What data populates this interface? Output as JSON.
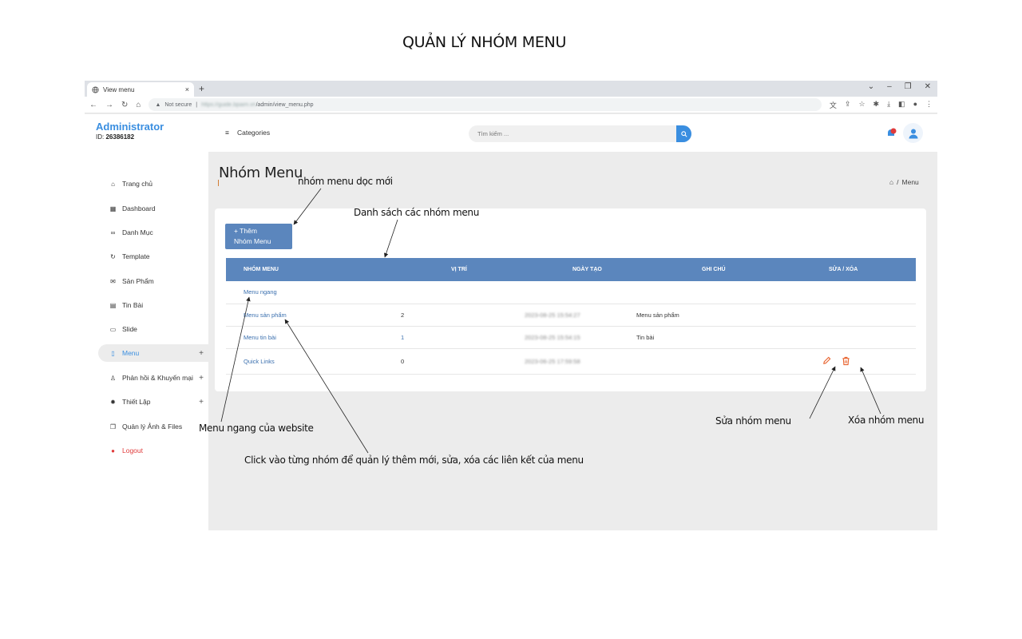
{
  "page_heading": "QUẢN LÝ NHÓM MENU",
  "browser": {
    "tab_title": "View menu",
    "tab_close": "×",
    "new_tab": "+",
    "url_security": "Not secure",
    "url_host": "https://guide.bpaim.vn",
    "url_path": "/admin/view_menu.php"
  },
  "header": {
    "brand": "Administrator",
    "id_label": "ID:",
    "id_value": "26386182",
    "categories_label": "Categories",
    "search_placeholder": "Tìm kiếm ..."
  },
  "sidebar": {
    "items": [
      {
        "label": "Trang chủ",
        "icon": "home-icon"
      },
      {
        "label": "Dashboard",
        "icon": "grid-icon"
      },
      {
        "label": "Danh Mục",
        "icon": "link-icon"
      },
      {
        "label": "Template",
        "icon": "refresh-icon"
      },
      {
        "label": "Sản Phẩm",
        "icon": "envelope-icon"
      },
      {
        "label": "Tin Bài",
        "icon": "newspaper-icon"
      },
      {
        "label": "Slide",
        "icon": "monitor-icon"
      },
      {
        "label": "Menu",
        "icon": "document-icon"
      },
      {
        "label": "Phản hồi & Khuyến mại",
        "icon": "user-icon"
      },
      {
        "label": "Thiết Lập",
        "icon": "gear-icon"
      },
      {
        "label": "Quản lý Ảnh & Files",
        "icon": "files-icon"
      },
      {
        "label": "Logout",
        "icon": "power-icon"
      }
    ],
    "plus": "+"
  },
  "main": {
    "title": "Nhóm Menu",
    "breadcrumb": "Menu",
    "breadcrumb_sep": "/",
    "add_button_line1": "+ Thêm",
    "add_button_line2": "Nhóm Menu",
    "columns": [
      "NHÓM MENU",
      "VỊ TRÍ",
      "NGÀY TẠO",
      "GHI CHÚ",
      "SỬA / XÓA"
    ],
    "rows": [
      {
        "name": "Menu ngang",
        "position": "",
        "created": "",
        "note": ""
      },
      {
        "name": "Menu sản phẩm",
        "position": "2",
        "created": "2023-08-25 15:54:27",
        "note": "Menu sản phẩm"
      },
      {
        "name": "Menu tin bài",
        "position": "1",
        "created": "2023-08-25 15:54:15",
        "note": "Tin bài"
      },
      {
        "name": "Quick Links",
        "position": "0",
        "created": "2023-06-25 17:59:58",
        "note": ""
      }
    ]
  },
  "annotations": {
    "new_group": "nhóm menu dọc mới",
    "list": "Danh sách các nhóm menu",
    "horizontal": "Menu ngang của website",
    "click_group": "Click vào từng nhóm để  quản lý thêm mới, sửa, xóa các liên kết của menu",
    "edit": "Sửa  nhóm menu",
    "delete": "Xóa  nhóm menu"
  },
  "colors": {
    "accent": "#3a8ee0",
    "table_header": "#5b86bd",
    "edit_icon": "#e8612c",
    "delete_icon": "#e8612c",
    "notification": "#e03b3b"
  }
}
